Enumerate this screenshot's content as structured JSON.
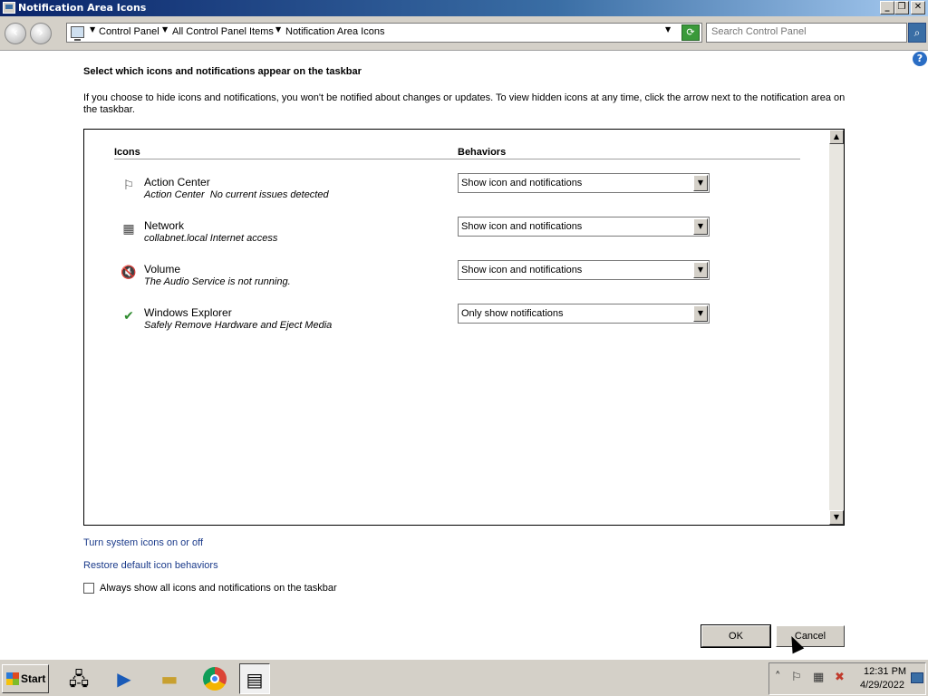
{
  "window": {
    "title": "Notification Area Icons",
    "controls": {
      "minimize": "_",
      "maximize": "❐",
      "close": "✕"
    }
  },
  "address": {
    "crumbs": [
      "Control Panel",
      "All Control Panel Items",
      "Notification Area Icons"
    ],
    "search_placeholder": "Search Control Panel"
  },
  "main": {
    "heading": "Select which icons and notifications appear on the taskbar",
    "description": "If you choose to hide icons and notifications, you won't be notified about changes or updates. To view hidden icons at any time, click the arrow next to the notification area on the taskbar.",
    "columns": {
      "icons": "Icons",
      "behaviors": "Behaviors"
    },
    "rows": [
      {
        "name": "Action Center",
        "sub": "Action Center  No current issues detected",
        "behavior": "Show icon and notifications",
        "icon": "flag-icon"
      },
      {
        "name": "Network",
        "sub": "collabnet.local Internet access",
        "behavior": "Show icon and notifications",
        "icon": "network-icon"
      },
      {
        "name": "Volume",
        "sub": "The Audio Service is not running.",
        "behavior": "Show icon and notifications",
        "icon": "volume-muted-icon"
      },
      {
        "name": "Windows Explorer",
        "sub": "Safely Remove Hardware and Eject Media",
        "behavior": "Only show notifications",
        "icon": "safely-remove-icon"
      }
    ],
    "links": {
      "system_icons": "Turn system icons on or off",
      "restore": "Restore default icon behaviors"
    },
    "checkbox_label": "Always show all icons and notifications on the taskbar",
    "checkbox_checked": false,
    "ok_label": "OK",
    "cancel_label": "Cancel"
  },
  "taskbar": {
    "start_label": "Start",
    "time": "12:31 PM",
    "date": "4/29/2022"
  }
}
